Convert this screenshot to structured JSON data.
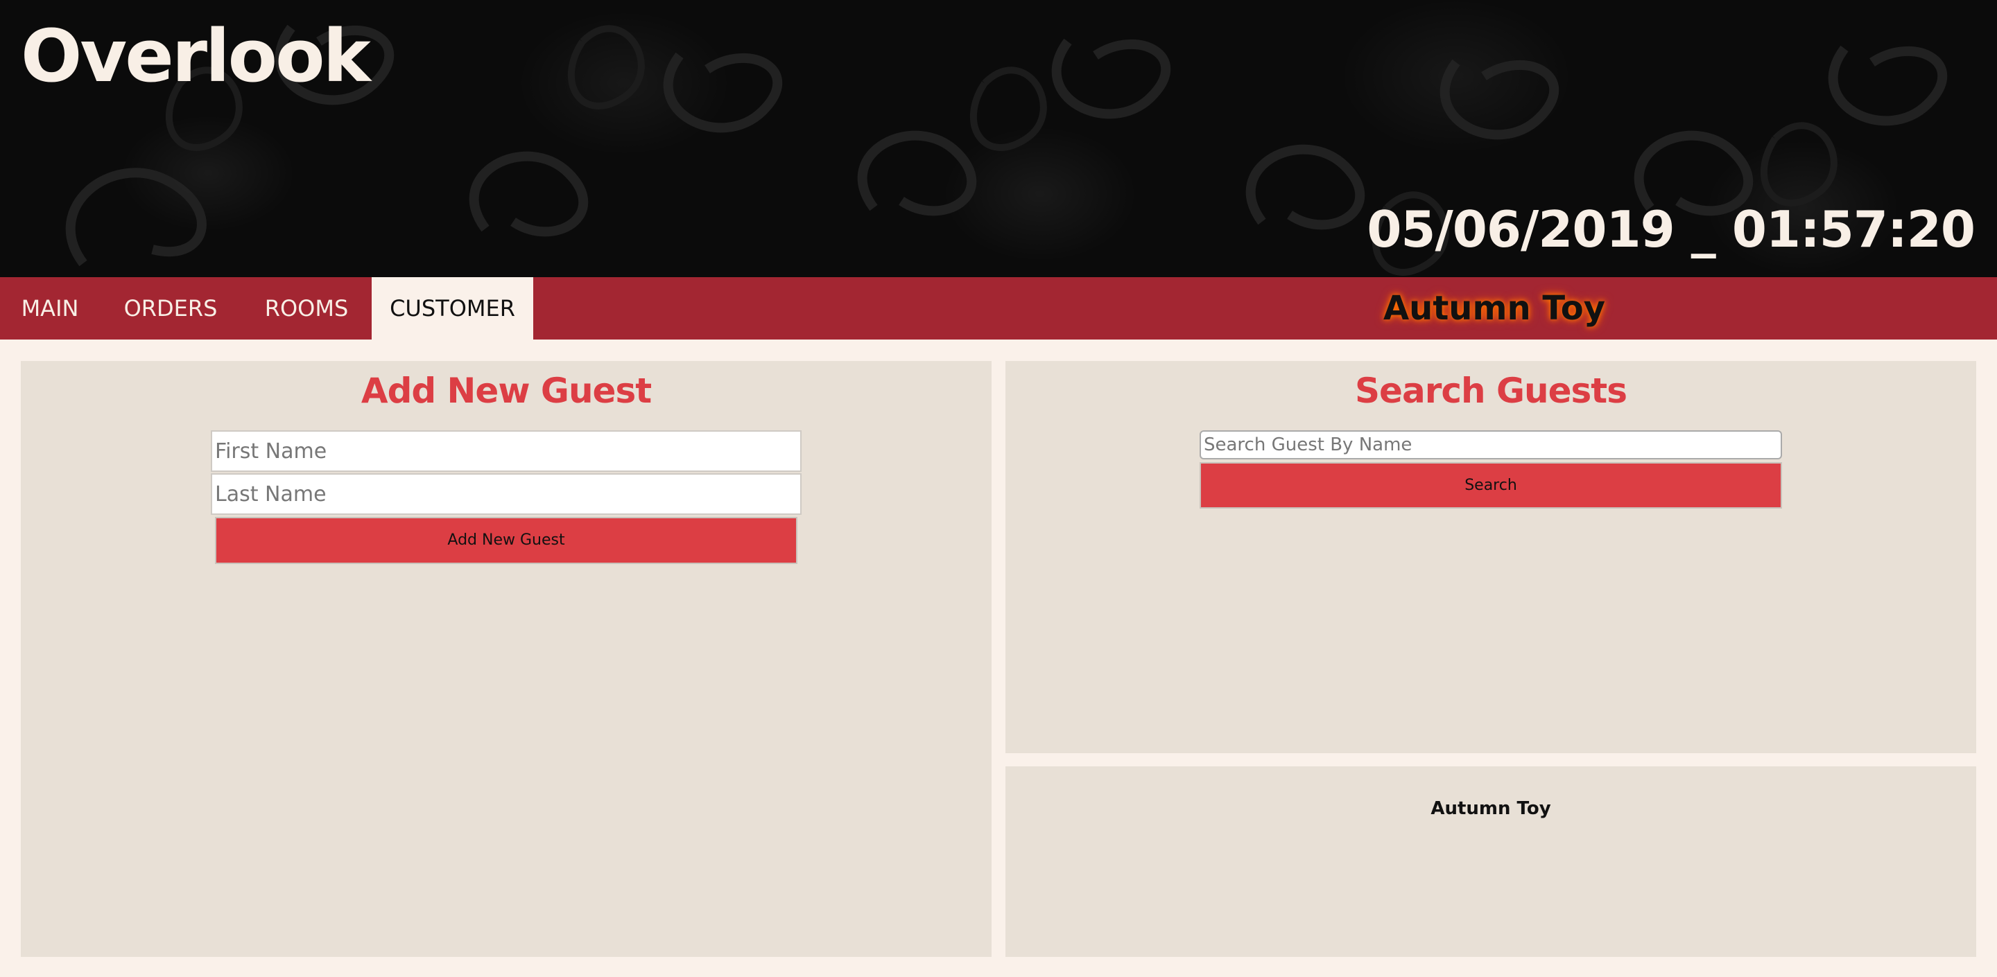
{
  "app": {
    "title": "Overlook",
    "datetime": "05/06/2019 _ 01:57:20"
  },
  "nav": {
    "tabs": [
      {
        "label": "MAIN",
        "active": false
      },
      {
        "label": "ORDERS",
        "active": false
      },
      {
        "label": "ROOMS",
        "active": false
      },
      {
        "label": "CUSTOMER",
        "active": true
      }
    ],
    "current_user": "Autumn Toy"
  },
  "add_guest": {
    "title": "Add New Guest",
    "first_name_placeholder": "First Name",
    "first_name_value": "",
    "last_name_placeholder": "Last Name",
    "last_name_value": "",
    "submit_label": "Add New Guest"
  },
  "search_guests": {
    "title": "Search Guests",
    "search_placeholder": "Search Guest By Name",
    "search_value": "",
    "search_button_label": "Search"
  },
  "selected_guest": {
    "name": "Autumn Toy"
  },
  "colors": {
    "accent": "#dc3e44",
    "nav_bar": "#a32632",
    "panel": "#e8e0d6",
    "page_background": "#faf1ea",
    "header_background": "#0b0b0b"
  }
}
